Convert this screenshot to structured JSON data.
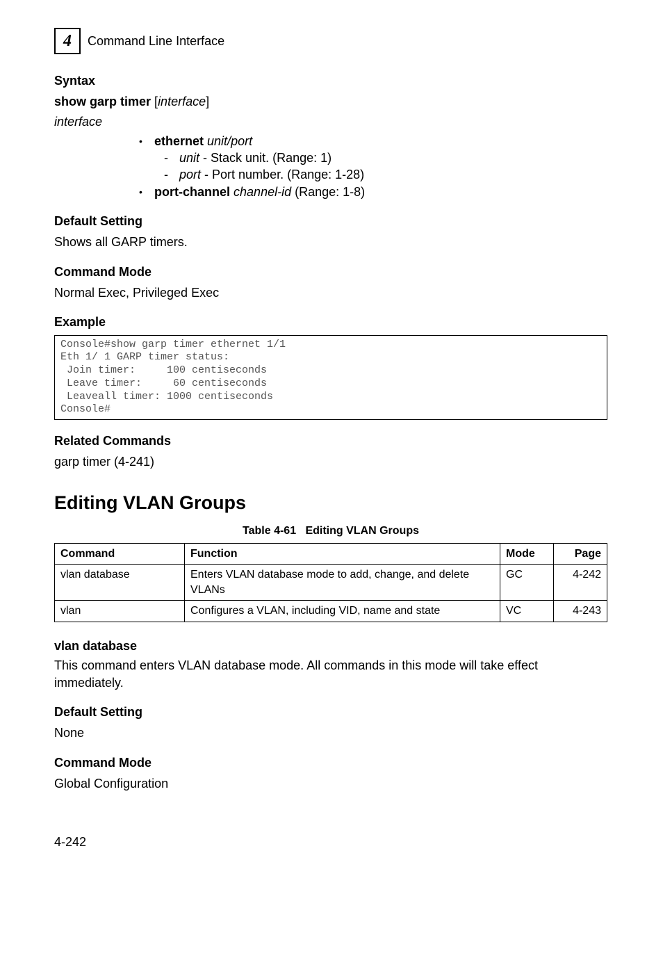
{
  "header": {
    "chapter_number": "4",
    "chapter_title": "Command Line Interface"
  },
  "syntax": {
    "heading": "Syntax",
    "cmd_static": "show garp timer",
    "cmd_arg": "interface",
    "interface_label": "interface",
    "eth_label": "ethernet",
    "eth_args": "unit",
    "eth_sep": "/",
    "eth_args2": "port",
    "unit_name": "unit",
    "unit_desc": " - Stack unit. (Range: 1)",
    "port_name": "port",
    "port_desc": " - Port number. (Range: 1-28)",
    "portchannel_label": "port-channel",
    "portchannel_arg": "channel-id",
    "portchannel_desc": " (Range: 1-8)"
  },
  "default_setting": {
    "heading": "Default Setting",
    "text": "Shows all GARP timers."
  },
  "command_mode": {
    "heading": "Command Mode",
    "text": "Normal Exec, Privileged Exec"
  },
  "example": {
    "heading": "Example",
    "code": "Console#show garp timer ethernet 1/1\nEth 1/ 1 GARP timer status:\n Join timer:     100 centiseconds\n Leave timer:     60 centiseconds\n Leaveall timer: 1000 centiseconds\nConsole#"
  },
  "related": {
    "heading": "Related Commands",
    "text": "garp timer (4-241)"
  },
  "section_title": "Editing VLAN Groups",
  "table": {
    "caption_prefix": "Table 4-61",
    "caption": "Editing VLAN Groups",
    "headers": {
      "command": "Command",
      "function": "Function",
      "mode": "Mode",
      "page": "Page"
    },
    "rows": [
      {
        "command": "vlan database",
        "function": "Enters VLAN database mode to add, change, and delete VLANs",
        "mode": "GC",
        "page": "4-242"
      },
      {
        "command": "vlan",
        "function": "Configures a VLAN, including VID, name and state",
        "mode": "VC",
        "page": "4-243"
      }
    ]
  },
  "vlan_db": {
    "heading": "vlan database",
    "desc": "This command enters VLAN database mode. All commands in this mode will take effect immediately.",
    "default_heading": "Default Setting",
    "default_text": "None",
    "mode_heading": "Command Mode",
    "mode_text": "Global Configuration"
  },
  "footer": {
    "page": "4-242"
  }
}
